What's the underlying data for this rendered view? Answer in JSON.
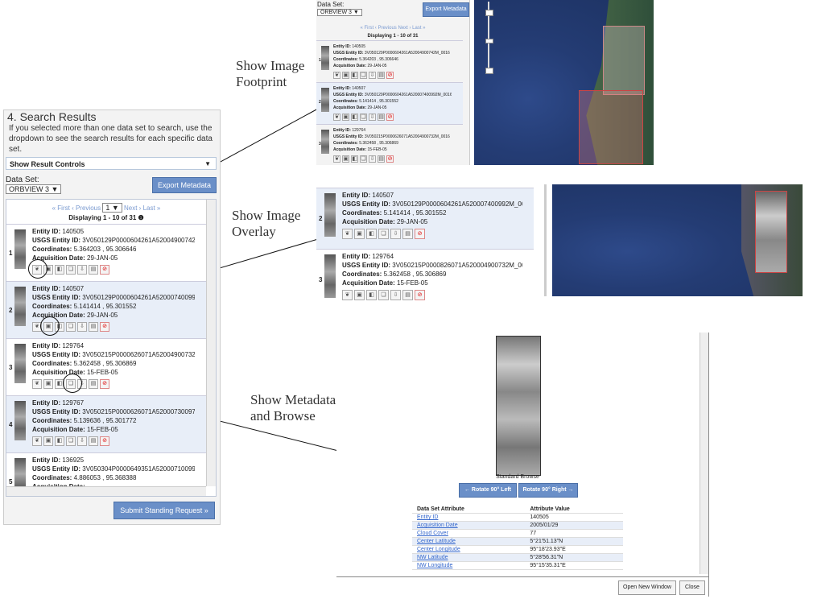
{
  "captions": {
    "footprint": [
      "Show Image",
      "Footprint"
    ],
    "overlay": [
      "Show Image",
      "Overlay"
    ],
    "metadata": [
      "Show Metadata",
      "and Browse"
    ]
  },
  "main": {
    "title": "4. Search Results",
    "note": "If you selected more than one data set to search, use the dropdown to see the search results for each specific data set.",
    "controls_label": "Show Result Controls",
    "dataset_label": "Data Set:",
    "dataset_value": "ORBVIEW 3",
    "export_label": "Export Metadata",
    "pager": {
      "first": "« First",
      "prev": "‹ Previous",
      "page": "1",
      "next": "Next ›",
      "last": "Last »"
    },
    "displaying": "Displaying 1 - 10 of 31",
    "submit_label": "Submit Standing Request »"
  },
  "field_labels": {
    "entity": "Entity ID:",
    "usgs": "USGS Entity ID:",
    "coords": "Coordinates:",
    "date": "Acquisition Date:"
  },
  "results": [
    {
      "num": "1",
      "entity": "140505",
      "usgs": "3V050129P0000604261A52004900742M_0016",
      "coords": "5.364203 , 95.306646",
      "date": "29-JAN-05"
    },
    {
      "num": "2",
      "entity": "140507",
      "usgs": "3V050129P0000604261A520007400992M_0016",
      "coords": "5.141414 , 95.301552",
      "date": "29-JAN-05"
    },
    {
      "num": "3",
      "entity": "129764",
      "usgs": "3V050215P0000626071A52004900732M_0016",
      "coords": "5.362458 , 95.306869",
      "date": "15-FEB-05"
    },
    {
      "num": "4",
      "entity": "129767",
      "usgs": "3V050215P0000626071A52000730097M_0016",
      "coords": "5.139636 , 95.301772",
      "date": "15-FEB-05"
    },
    {
      "num": "5",
      "entity": "136925",
      "usgs": "3V050304P0000649351A52000710099M_0016",
      "coords": "4.886053 , 95.368388",
      "date": ""
    }
  ],
  "overlay_results": [
    {
      "num": "2",
      "entity": "140507",
      "usgs": "3V050129P0000604261A520007400992M_0016",
      "coords": "5.141414 , 95.301552",
      "date": "29-JAN-05"
    },
    {
      "num": "3",
      "entity": "129764",
      "usgs": "3V050215P0000826071A520004900732M_0016",
      "coords": "5.362458 , 95.306869",
      "date": "15-FEB-05"
    }
  ],
  "browse": {
    "caption": "Standard Browse",
    "rotate_left": "← Rotate 90° Left",
    "rotate_right": "Rotate 90° Right →",
    "table_headers": [
      "Data Set Attribute",
      "Attribute Value"
    ],
    "rows": [
      [
        "Entity ID",
        "140505"
      ],
      [
        "Acquisition Date",
        "2005/01/29"
      ],
      [
        "Cloud Cover",
        "77"
      ],
      [
        "Center Latitude",
        "5°21'51.13\"N"
      ],
      [
        "Center Longitude",
        "95°18'23.93\"E"
      ],
      [
        "NW Latitude",
        "5°28'56.31\"N"
      ],
      [
        "NW Longitude",
        "95°15'35.31\"E"
      ]
    ],
    "open_window": "Open New Window",
    "close": "Close"
  },
  "icons": [
    "footprint-icon",
    "overlay-icon",
    "compare-icon",
    "metadata-icon",
    "download-icon",
    "bulk-icon",
    "exclude-icon"
  ],
  "colors": {
    "accent": "#6a8fc8",
    "selected": "#e8eef8",
    "exclude": "#dd0000"
  }
}
